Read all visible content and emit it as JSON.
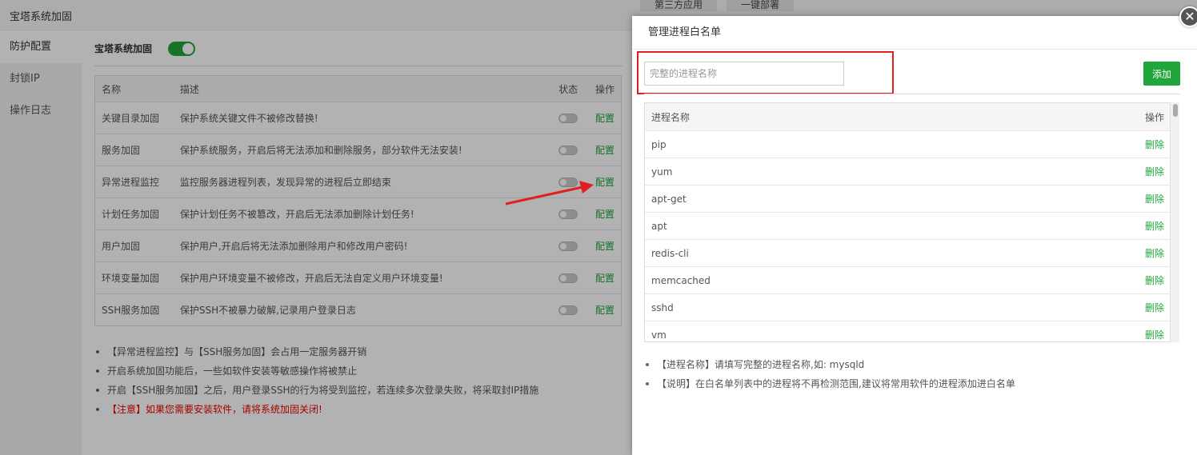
{
  "app": {
    "title": "宝塔系统加固",
    "top_tabs": [
      "第三方应用",
      "一键部署"
    ]
  },
  "sidebar": {
    "items": [
      {
        "label": "防护配置",
        "active": true
      },
      {
        "label": "封锁IP",
        "active": false
      },
      {
        "label": "操作日志",
        "active": false
      }
    ]
  },
  "main": {
    "switch_label": "宝塔系统加固",
    "switch_on": true,
    "table": {
      "headers": {
        "name": "名称",
        "desc": "描述",
        "state": "状态",
        "op": "操作"
      },
      "rows": [
        {
          "name": "关键目录加固",
          "desc": "保护系统关键文件不被修改替换!",
          "op": "配置"
        },
        {
          "name": "服务加固",
          "desc": "保护系统服务，开启后将无法添加和删除服务，部分软件无法安装!",
          "op": "配置"
        },
        {
          "name": "异常进程监控",
          "desc": "监控服务器进程列表，发现异常的进程后立即结束",
          "op": "配置"
        },
        {
          "name": "计划任务加固",
          "desc": "保护计划任务不被篡改，开启后无法添加删除计划任务!",
          "op": "配置"
        },
        {
          "name": "用户加固",
          "desc": "保护用户,开启后将无法添加删除用户和修改用户密码!",
          "op": "配置"
        },
        {
          "name": "环境变量加固",
          "desc": "保护用户环境变量不被修改，开启后无法自定义用户环境变量!",
          "op": "配置"
        },
        {
          "name": "SSH服务加固",
          "desc": "保护SSH不被暴力破解,记录用户登录日志",
          "op": "配置"
        }
      ]
    },
    "notes": [
      "【异常进程监控】与【SSH服务加固】会占用一定服务器开销",
      "开启系统加固功能后，一些如软件安装等敏感操作将被禁止",
      "开启【SSH服务加固】之后，用户登录SSH的行为将受到监控，若连续多次登录失败，将采取封IP措施",
      "【注意】如果您需要安装软件，请将系统加固关闭!"
    ]
  },
  "modal": {
    "title": "管理进程白名单",
    "input_placeholder": "完整的进程名称",
    "input_value": "",
    "add_label": "添加",
    "close_icon": "✕",
    "table_headers": {
      "name": "进程名称",
      "op": "操作"
    },
    "processes": [
      "pip",
      "yum",
      "apt-get",
      "apt",
      "redis-cli",
      "memcached",
      "sshd",
      "vm"
    ],
    "delete_label": "删除",
    "notes": [
      "【进程名称】请填写完整的进程名称,如: mysqld",
      "【说明】在白名单列表中的进程将不再检测范围,建议将常用软件的进程添加进白名单"
    ]
  },
  "colors": {
    "accent_green": "#20a53a",
    "highlight_red": "#e02020",
    "warning_text": "#e00000"
  }
}
